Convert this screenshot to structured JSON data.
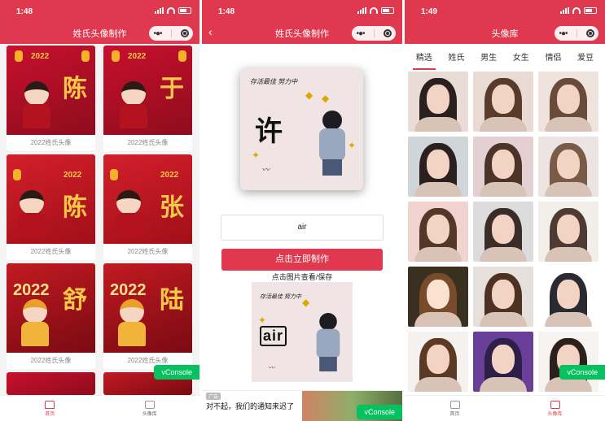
{
  "colors": {
    "brand": "#e0394f",
    "vconsole": "#07c160"
  },
  "screen1": {
    "status_time": "1:48",
    "title": "姓氏头像制作",
    "cards": [
      {
        "caption": "2022姓氏头像",
        "surname": "陈",
        "style": "red"
      },
      {
        "caption": "2022姓氏头像",
        "surname": "于",
        "style": "red"
      },
      {
        "caption": "2022姓氏头像",
        "surname": "陈",
        "style": "alt"
      },
      {
        "caption": "2022姓氏头像",
        "surname": "张",
        "style": "alt"
      },
      {
        "caption": "2022姓氏头像",
        "surname": "舒",
        "style": "gold"
      },
      {
        "caption": "2022姓氏头像",
        "surname": "陆",
        "style": "gold"
      }
    ],
    "year_label": "2022",
    "vconsole": "vConsole",
    "tabs": [
      {
        "label": "首页",
        "icon": "home-icon"
      },
      {
        "label": "头像库",
        "icon": "gallery-icon"
      }
    ]
  },
  "screen2": {
    "status_time": "1:48",
    "title": "姓氏头像制作",
    "preview_surname": "许",
    "preview_tagline": "存活最佳 努力中",
    "preview_sign": "签名",
    "input_value": "air",
    "make_button": "点击立即制作",
    "hint": "点击图片查看/保存",
    "result_name": "air",
    "ad_tag": "广告",
    "ad_text": "对不起，我们的通知来迟了",
    "vconsole": "vConsole"
  },
  "screen3": {
    "status_time": "1:49",
    "title": "头像库",
    "categories": [
      "精选",
      "姓氏",
      "男生",
      "女生",
      "情侣",
      "爱豆"
    ],
    "active_category": "精选",
    "vconsole": "vConsole",
    "tabs": [
      {
        "label": "首页",
        "icon": "home-icon"
      },
      {
        "label": "头像库",
        "icon": "gallery-icon"
      }
    ]
  }
}
